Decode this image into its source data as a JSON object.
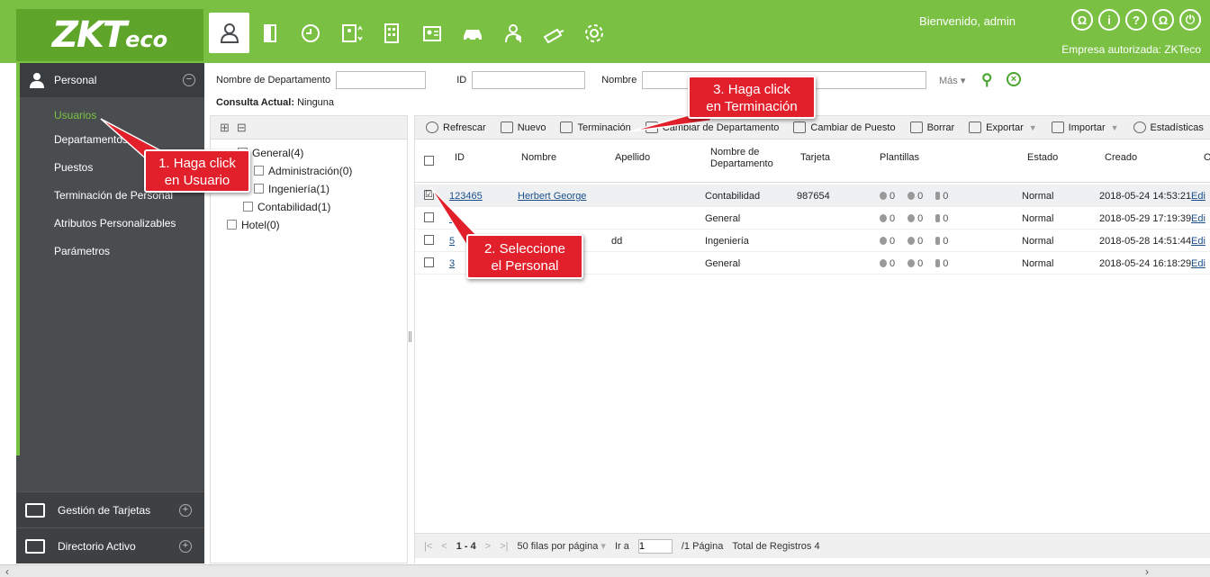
{
  "brand": {
    "logo_main": "ZKT",
    "logo_suffix": "eco",
    "bg_color": "#7ac143"
  },
  "header": {
    "modules": [
      "personnel-icon",
      "door-icon",
      "clock-icon",
      "elevator-icon",
      "building-icon",
      "visitor-icon",
      "car-icon",
      "patrol-icon",
      "camera-icon",
      "gear-icon"
    ],
    "welcome": "Bienvenido, admin",
    "company": "Empresa autorizada: ZKTeco",
    "icons": [
      {
        "name": "user-icon",
        "glyph": "Ω"
      },
      {
        "name": "info-icon",
        "glyph": "i"
      },
      {
        "name": "help-icon",
        "glyph": "?"
      },
      {
        "name": "profile-icon",
        "glyph": "Ω"
      },
      {
        "name": "power-icon",
        "glyph": "⏻"
      }
    ]
  },
  "sidebar": {
    "section": "Personal",
    "items": [
      "Usuarios",
      "Departamentos",
      "Puestos",
      "Terminación de Personal",
      "Atributos Personalizables",
      "Parámetros"
    ],
    "footer": [
      "Gestión de Tarjetas",
      "Directorio Activo"
    ]
  },
  "search": {
    "dept_label": "Nombre de Departamento",
    "id_label": "ID",
    "name_label": "Nombre",
    "more": "Más",
    "consulta_label": "Consulta Actual:",
    "consulta_value": "Ninguna"
  },
  "tree": {
    "nodes": [
      {
        "label": "General(4)"
      },
      {
        "label": "Administración(0)"
      },
      {
        "label": "Ingeniería(1)"
      },
      {
        "label": "Contabilidad(1)"
      },
      {
        "label": "Hotel(0)"
      }
    ]
  },
  "toolbar": [
    "Refrescar",
    "Nuevo",
    "Terminación",
    "Cambiar de Departamento",
    "Cambiar de Puesto",
    "Borrar",
    "Exportar",
    "Importar",
    "Estadísticas"
  ],
  "columns": [
    "ID",
    "Nombre",
    "Apellido",
    "Nombre de Departamento",
    "Tarjeta",
    "Plantillas",
    "Estado",
    "Creado",
    "O"
  ],
  "rows": [
    {
      "id": "123465",
      "nombre": "Herbert George",
      "apellido": "",
      "dept": "Contabilidad",
      "tarjeta": "987654",
      "t1": "0",
      "t2": "0",
      "t3": "0",
      "estado": "Normal",
      "creado": "2018-05-24 14:53:21",
      "op": "Edi",
      "checked": "☑"
    },
    {
      "id": "6",
      "nombre": "",
      "apellido": "",
      "dept": "General",
      "tarjeta": "",
      "t1": "0",
      "t2": "0",
      "t3": "0",
      "estado": "Normal",
      "creado": "2018-05-29 17:19:39",
      "op": "Edi",
      "checked": ""
    },
    {
      "id": "5",
      "nombre": "",
      "apellido": "dd",
      "dept": "Ingeniería",
      "tarjeta": "",
      "t1": "0",
      "t2": "0",
      "t3": "0",
      "estado": "Normal",
      "creado": "2018-05-28 14:51:44",
      "op": "Edi",
      "checked": ""
    },
    {
      "id": "3",
      "nombre": "",
      "apellido": "",
      "dept": "General",
      "tarjeta": "",
      "t1": "0",
      "t2": "0",
      "t3": "0",
      "estado": "Normal",
      "creado": "2018-05-24 16:18:29",
      "op": "Edi",
      "checked": ""
    }
  ],
  "pager": {
    "first": "|<",
    "prev": "<",
    "range": "1 - 4",
    "next": ">",
    "last": ">|",
    "per_page": "50 filas por página",
    "goto_label": "Ir a",
    "goto_value": "1",
    "pages": "/1 Página",
    "total": "Total de Registros 4"
  },
  "callouts": {
    "c1": "1. Haga click\nen Usuario",
    "c2": "2. Seleccione\nel Personal",
    "c3": "3. Haga click\nen Terminación"
  }
}
